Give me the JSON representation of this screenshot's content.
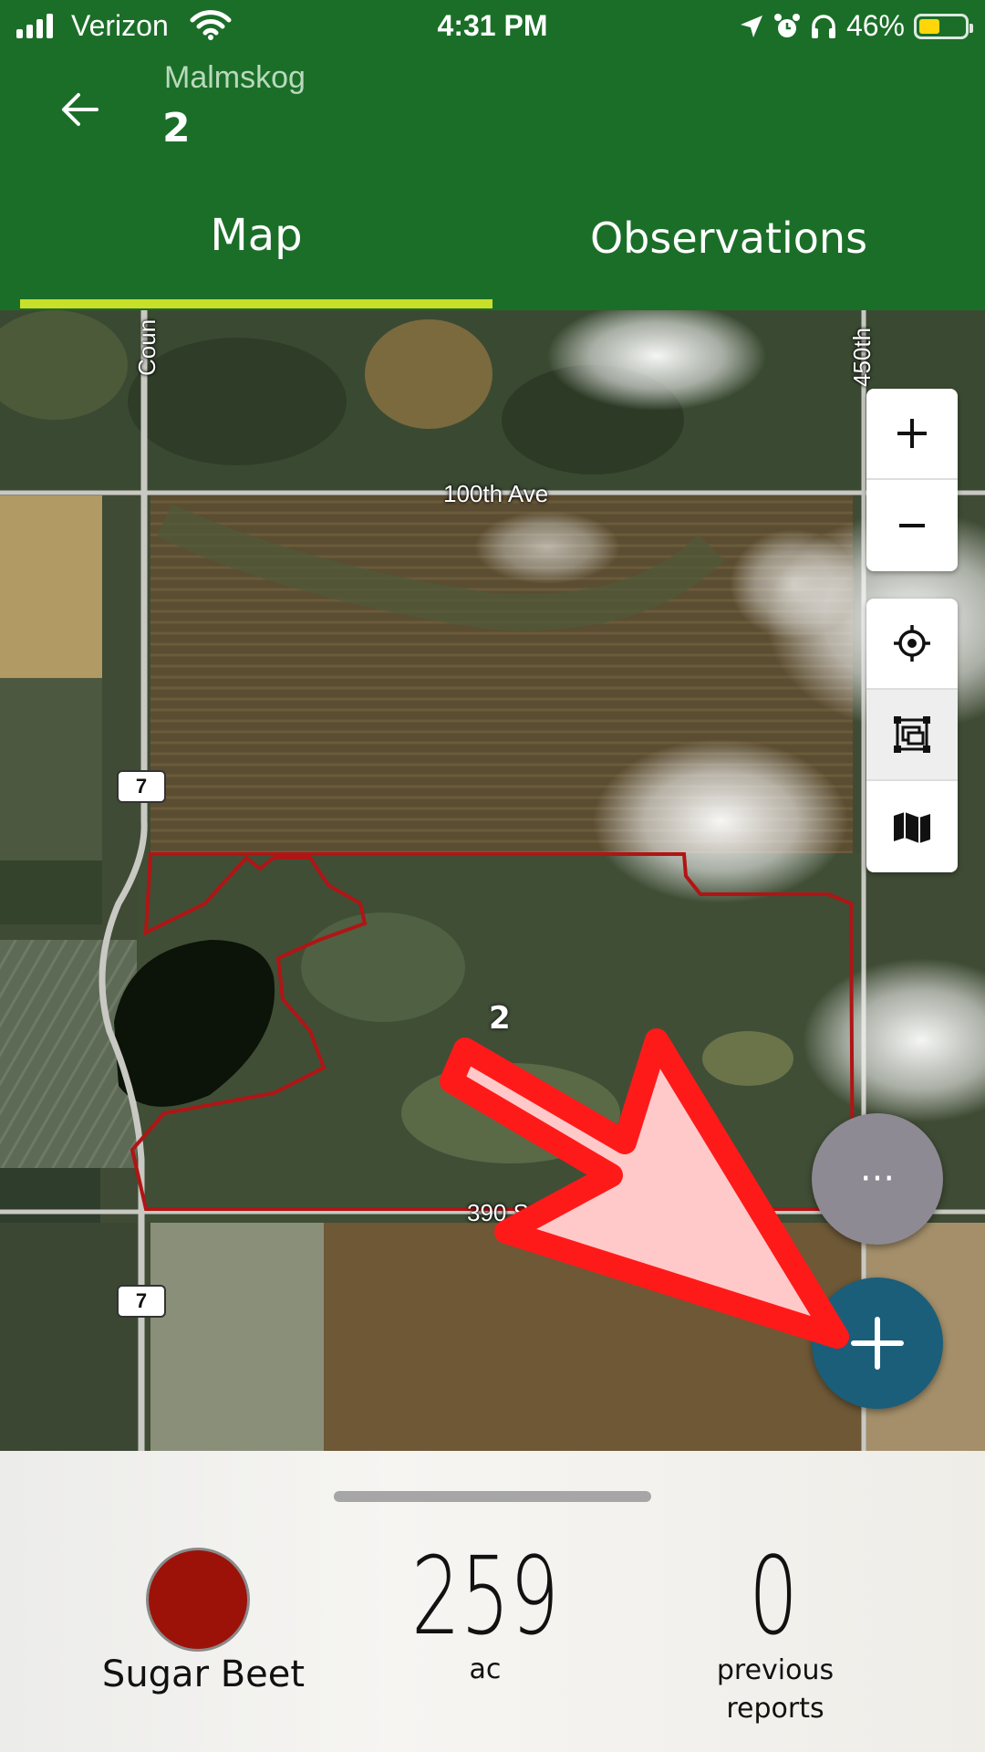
{
  "status_bar": {
    "carrier": "Verizon",
    "time": "4:31 PM",
    "battery": "46%",
    "battery_level": 0.46,
    "icons": [
      "signal-icon",
      "wifi-icon",
      "location-arrow-icon",
      "alarm-icon",
      "headphones-icon",
      "battery-icon"
    ]
  },
  "header": {
    "back_icon": "arrow-left-icon",
    "subtitle": "Malmskog",
    "title": "2"
  },
  "tabs": [
    {
      "label": "Map",
      "active": true
    },
    {
      "label": "Observations",
      "active": false
    }
  ],
  "map": {
    "road_labels": [
      "100th Ave",
      "390 St",
      "Coun",
      "450th"
    ],
    "shields": [
      "7",
      "7"
    ],
    "field_label": "2",
    "controls": {
      "zoom": [
        "plus-icon",
        "minus-icon"
      ],
      "tools": [
        "crosshair-locate-icon",
        "fit-bounds-icon",
        "map-layers-icon"
      ]
    },
    "fab_more_label": "···",
    "fab_add_icon": "plus-icon",
    "accent_arrow_color": "#ff1a1a",
    "boundary_color": "#b01515"
  },
  "summary": {
    "crop_name": "Sugar Beet",
    "crop_color": "#9c1209",
    "acres": "259",
    "acres_unit": "ac",
    "reports": "0",
    "reports_label_1": "previous",
    "reports_label_2": "reports"
  },
  "colors": {
    "header_green": "#1b6e28",
    "tab_indicator": "#c8e02a",
    "fab_blue": "#1b5e7a",
    "fab_gray": "#8d8a93"
  }
}
